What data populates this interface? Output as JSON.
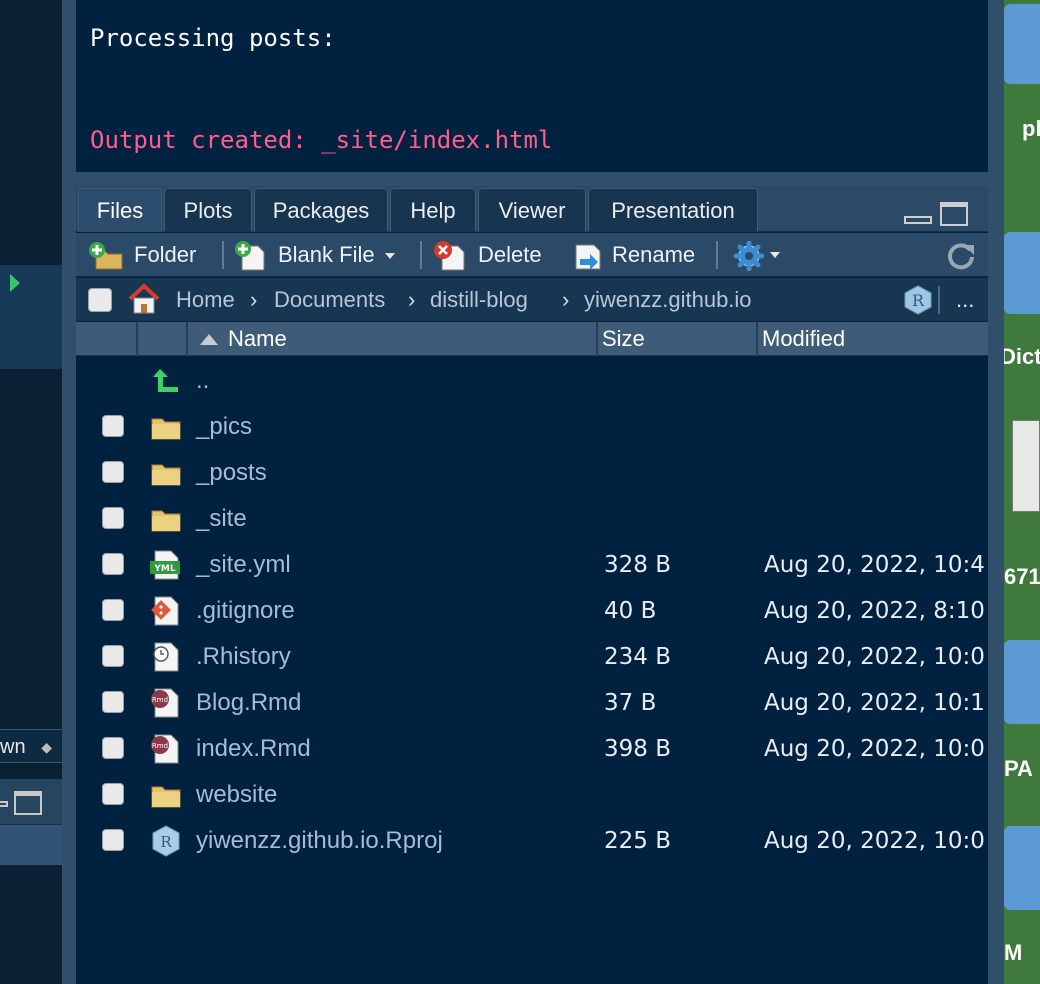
{
  "console": {
    "line1": "Processing posts:",
    "line2": "Output created: _site/index.html",
    "line2_color": "#ff5e8a"
  },
  "left_strip": {
    "select_text": "wn",
    "select_arrows": "◆"
  },
  "files_pane": {
    "tabs": [
      {
        "label": "Files",
        "active": true
      },
      {
        "label": "Plots",
        "active": false
      },
      {
        "label": "Packages",
        "active": false
      },
      {
        "label": "Help",
        "active": false
      },
      {
        "label": "Viewer",
        "active": false
      },
      {
        "label": "Presentation",
        "active": false
      }
    ],
    "toolbar": {
      "folder_label": "Folder",
      "blank_file_label": "Blank File",
      "delete_label": "Delete",
      "rename_label": "Rename",
      "gear_icon": "gear-icon",
      "refresh_icon": "refresh-icon"
    },
    "path": {
      "home": "Home",
      "crumbs": [
        "Documents",
        "distill-blog",
        "yiwenzz.github.io"
      ],
      "more": "..."
    },
    "columns": {
      "name": "Name",
      "size": "Size",
      "modified": "Modified"
    },
    "parent_dir": "..",
    "files": [
      {
        "name": "_pics",
        "size": "",
        "modified": "",
        "icon": "folder-icon"
      },
      {
        "name": "_posts",
        "size": "",
        "modified": "",
        "icon": "folder-icon"
      },
      {
        "name": "_site",
        "size": "",
        "modified": "",
        "icon": "folder-icon"
      },
      {
        "name": "_site.yml",
        "size": "328 B",
        "modified": "Aug 20, 2022, 10:4",
        "icon": "yml-file-icon"
      },
      {
        "name": ".gitignore",
        "size": "40 B",
        "modified": "Aug 20, 2022, 8:10",
        "icon": "git-file-icon"
      },
      {
        "name": ".Rhistory",
        "size": "234 B",
        "modified": "Aug 20, 2022, 10:0",
        "icon": "history-file-icon"
      },
      {
        "name": "Blog.Rmd",
        "size": "37 B",
        "modified": "Aug 20, 2022, 10:1",
        "icon": "rmd-file-icon"
      },
      {
        "name": "index.Rmd",
        "size": "398 B",
        "modified": "Aug 20, 2022, 10:0",
        "icon": "rmd-file-icon"
      },
      {
        "name": "website",
        "size": "",
        "modified": "",
        "icon": "folder-icon"
      },
      {
        "name": "yiwenzz.github.io.Rproj",
        "size": "225 B",
        "modified": "Aug 20, 2022, 10:0",
        "icon": "rproj-file-icon"
      }
    ]
  },
  "desktop": {
    "labels": [
      "pl",
      "Dict",
      "671",
      "PA",
      "M"
    ]
  }
}
